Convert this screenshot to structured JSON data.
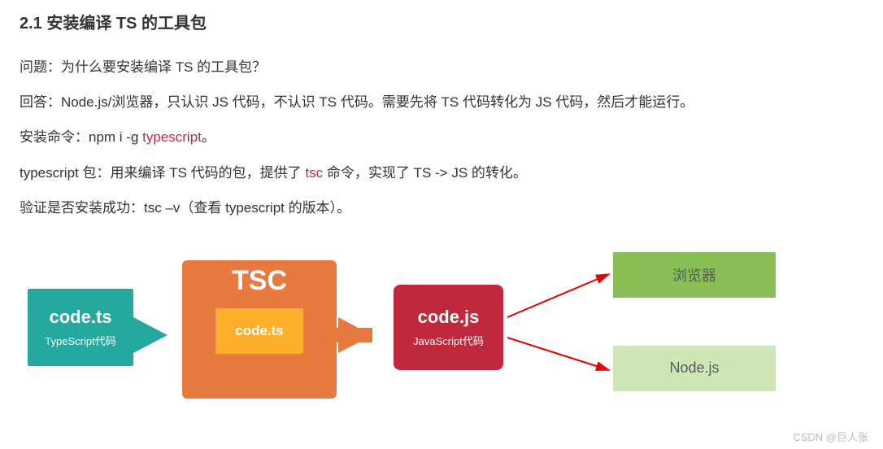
{
  "heading": "2.1 安装编译 TS 的工具包",
  "paragraphs": {
    "p1": "问题：为什么要安装编译 TS 的工具包？",
    "p2": "回答：Node.js/浏览器，只认识 JS 代码，不认识 TS 代码。需要先将 TS 代码转化为 JS 代码，然后才能运行。",
    "p3_pre": "安装命令：npm i -g ",
    "p3_hl": "typescript",
    "p3_post": "。",
    "p4_pre": "typescript 包：用来编译 TS 代码的包，提供了 ",
    "p4_hl": "tsc",
    "p4_post": " 命令，实现了 TS -> JS 的转化。",
    "p5": "验证是否安装成功：tsc –v（查看 typescript 的版本）。"
  },
  "diagram": {
    "ts_box": {
      "filename": "code.ts",
      "subtitle": "TypeScript代码"
    },
    "tsc_box": {
      "title": "TSC",
      "inner": "code.ts"
    },
    "js_box": {
      "filename": "code.js",
      "subtitle": "JavaScript代码"
    },
    "targets": {
      "browser": "浏览器",
      "node": "Node.js"
    }
  },
  "watermark": "CSDN @巨人张"
}
